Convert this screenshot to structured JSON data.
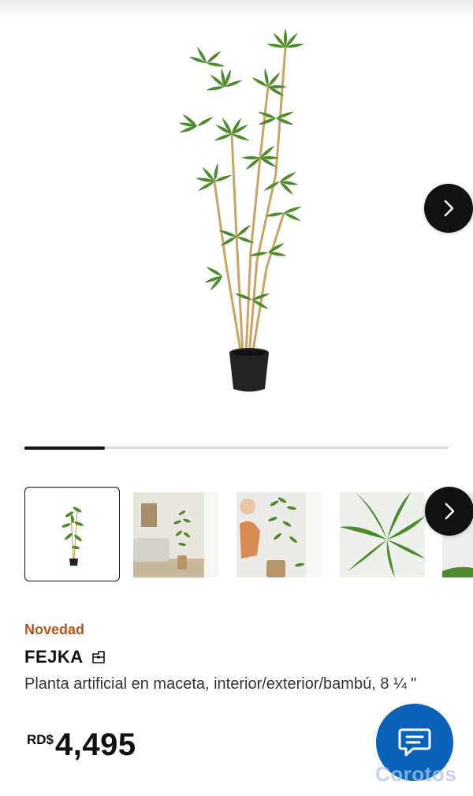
{
  "gallery": {
    "main_image": "bamboo plant in black pot",
    "progress": 0.19,
    "thumbnails": [
      {
        "id": "thumb-product",
        "selected": true
      },
      {
        "id": "thumb-living-room",
        "selected": false
      },
      {
        "id": "thumb-person-arranging",
        "selected": false
      },
      {
        "id": "thumb-leaf-closeup",
        "selected": false
      },
      {
        "id": "thumb-partial",
        "selected": false
      }
    ]
  },
  "product": {
    "badge": "Novedad",
    "name": "FEJKA",
    "description": "Planta artificial en maceta, interior/exterior/bambú, 8 ¼ \"",
    "currency": "RD$",
    "price": "4,495"
  },
  "icons": {
    "next": "chevron-right-icon",
    "package": "package-icon",
    "chat": "chat-bubble-icon"
  },
  "watermark": "Corotos",
  "colors": {
    "accent": "#b5541a",
    "chat": "#0a63b8",
    "dark": "#111111"
  }
}
